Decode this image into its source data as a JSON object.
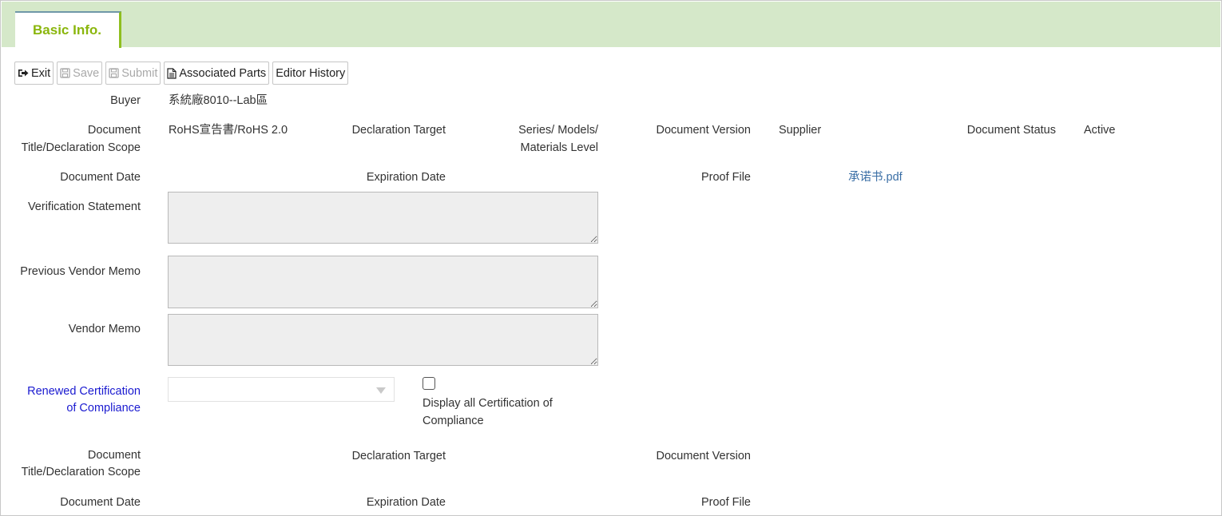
{
  "tab": {
    "label": "Basic Info."
  },
  "toolbar": {
    "exit": "Exit",
    "save": "Save",
    "submit": "Submit",
    "associated_parts": "Associated Parts",
    "editor_history": "Editor History"
  },
  "buyer": {
    "label": "Buyer",
    "value": "系統廠8010--Lab區"
  },
  "current": {
    "doc_title_label_1": "Document",
    "doc_title_label_2": "Title/Declaration Scope",
    "doc_title_value": "RoHS宣告書/RoHS 2.0",
    "declaration_target_label": "Declaration Target",
    "declaration_target_value_1": "Series/ Models/",
    "declaration_target_value_2": "Materials Level",
    "doc_version_label": "Document Version",
    "doc_version_value": "Supplier",
    "doc_status_label": "Document Status",
    "doc_status_value": "Active",
    "doc_date_label": "Document Date",
    "expiration_date_label": "Expiration Date",
    "proof_file_label": "Proof File",
    "proof_file_value": "承诺书.pdf"
  },
  "memos": {
    "verification_label": "Verification Statement",
    "previous_vendor_label": "Previous Vendor Memo",
    "vendor_label": "Vendor Memo"
  },
  "renewed": {
    "label_1": "Renewed Certification",
    "label_2": "of Compliance",
    "display_all_1": "Display all Certification of",
    "display_all_2": "Compliance"
  },
  "renewed_doc": {
    "doc_title_label_1": "Document",
    "doc_title_label_2": "Title/Declaration Scope",
    "declaration_target_label": "Declaration Target",
    "doc_version_label": "Document Version",
    "doc_date_label": "Document Date",
    "expiration_date_label": "Expiration Date",
    "proof_file_label": "Proof File"
  },
  "colors": {
    "tabbar_bg": "#d5e8c9",
    "tab_text": "#8ab60c",
    "link": "#3a6ea5",
    "label_blue": "#1a1ad0"
  }
}
